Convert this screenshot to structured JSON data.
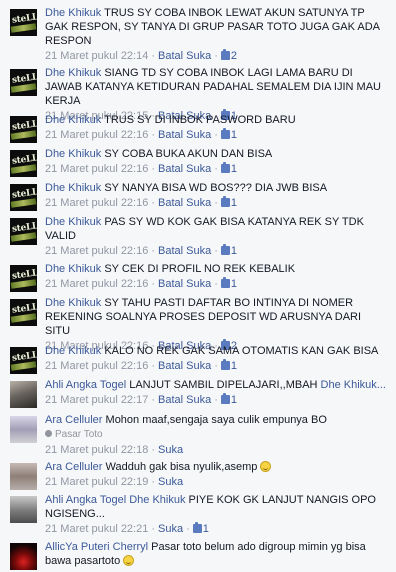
{
  "comments": [
    {
      "author": "Dhe Khikuk",
      "text": "TRUS SY COBA INBOK LEWAT AKUN SATUNYA TP GAK RESPON, SY TANYA DI GRUP PASAR TOTO JUGA GAK ADA RESPON",
      "time": "21 Maret pukul 22:14",
      "action": "Batal Suka",
      "likes": "2"
    },
    {
      "author": "Dhe Khikuk",
      "text": "SIANG TD SY COBA INBOK LAGI LAMA BARU DI JAWAB KATANYA KETIDURAN PADAHAL SEMALEM DIA IJIN MAU KERJA",
      "time": "21 Maret pukul 22:15",
      "action": "Batal Suka",
      "likes": "1"
    },
    {
      "author": "Dhe Khikuk",
      "text": "TRUS SY DI INBOK PASWORD BARU",
      "time": "21 Maret pukul 22:16",
      "action": "Batal Suka",
      "likes": "1"
    },
    {
      "author": "Dhe Khikuk",
      "text": "SY COBA BUKA AKUN DAN BISA",
      "time": "21 Maret pukul 22:16",
      "action": "Batal Suka",
      "likes": "1"
    },
    {
      "author": "Dhe Khikuk",
      "text": "SY NANYA BISA WD BOS??? DIA JWB BISA",
      "time": "21 Maret pukul 22:16",
      "action": "Batal Suka",
      "likes": "1"
    },
    {
      "author": "Dhe Khikuk",
      "text": "PAS SY WD KOK GAK BISA KATANYA REK SY TDK VALID",
      "time": "21 Maret pukul 22:16",
      "action": "Batal Suka",
      "likes": "1"
    },
    {
      "author": "Dhe Khikuk",
      "text": "SY CEK DI PROFIL NO REK KEBALIK",
      "time": "21 Maret pukul 22:16",
      "action": "Batal Suka",
      "likes": "1"
    },
    {
      "author": "Dhe Khikuk",
      "text": "SY TAHU PASTI DAFTAR BO INTINYA DI NOMER REKENING SOALNYA PROSES DEPOSIT WD ARUSNYA DARI SITU",
      "time": "21 Maret pukul 22:16",
      "action": "Batal Suka",
      "likes": "2"
    },
    {
      "author": "Dhe Khikuk",
      "text": "KALO NO REK GAK SAMA OTOMATIS KAN GAK BISA",
      "time": "21 Maret pukul 22:16",
      "action": "Batal Suka",
      "likes": "1"
    },
    {
      "author": "Ahli Angka Togel",
      "text": "LANJUT SAMBIL DIPELAJARI,,MBAH",
      "mention": "Dhe Khikuk...",
      "time": "21 Maret pukul 22:17",
      "action": "Batal Suka",
      "likes": "1"
    },
    {
      "author": "Ara Celluler",
      "text": "Mohon maaf,sengaja saya culik empunya BO",
      "location": "Pasar Toto",
      "time": "21 Maret pukul 22:18",
      "action": "Suka"
    },
    {
      "author": "Ara Celluler",
      "text": "Wadduh gak bisa nyulik,asemp",
      "time": "21 Maret pukul 22:19",
      "action": "Suka"
    },
    {
      "author": "Ahli Angka Togel",
      "mention": "Dhe Khikuk",
      "text": "PIYE KOK GK LANJUT NANGIS OPO NGISENG...",
      "time": "21 Maret pukul 22:21",
      "action": "Suka",
      "likes": "1"
    },
    {
      "author": "AllicYa Puteri Cherryl",
      "text": "Pasar toto belum ado digroup mimin yg bisa bawa pasartoto"
    }
  ],
  "icons": {
    "like": "thumbs-up-icon",
    "location": "map-pin-icon",
    "emoji": "smiley-icon",
    "avatar": "stell-logo-avatar"
  },
  "colors": {
    "link": "#3b5998",
    "meta": "#9197a3",
    "background": "#f6f7f9"
  }
}
